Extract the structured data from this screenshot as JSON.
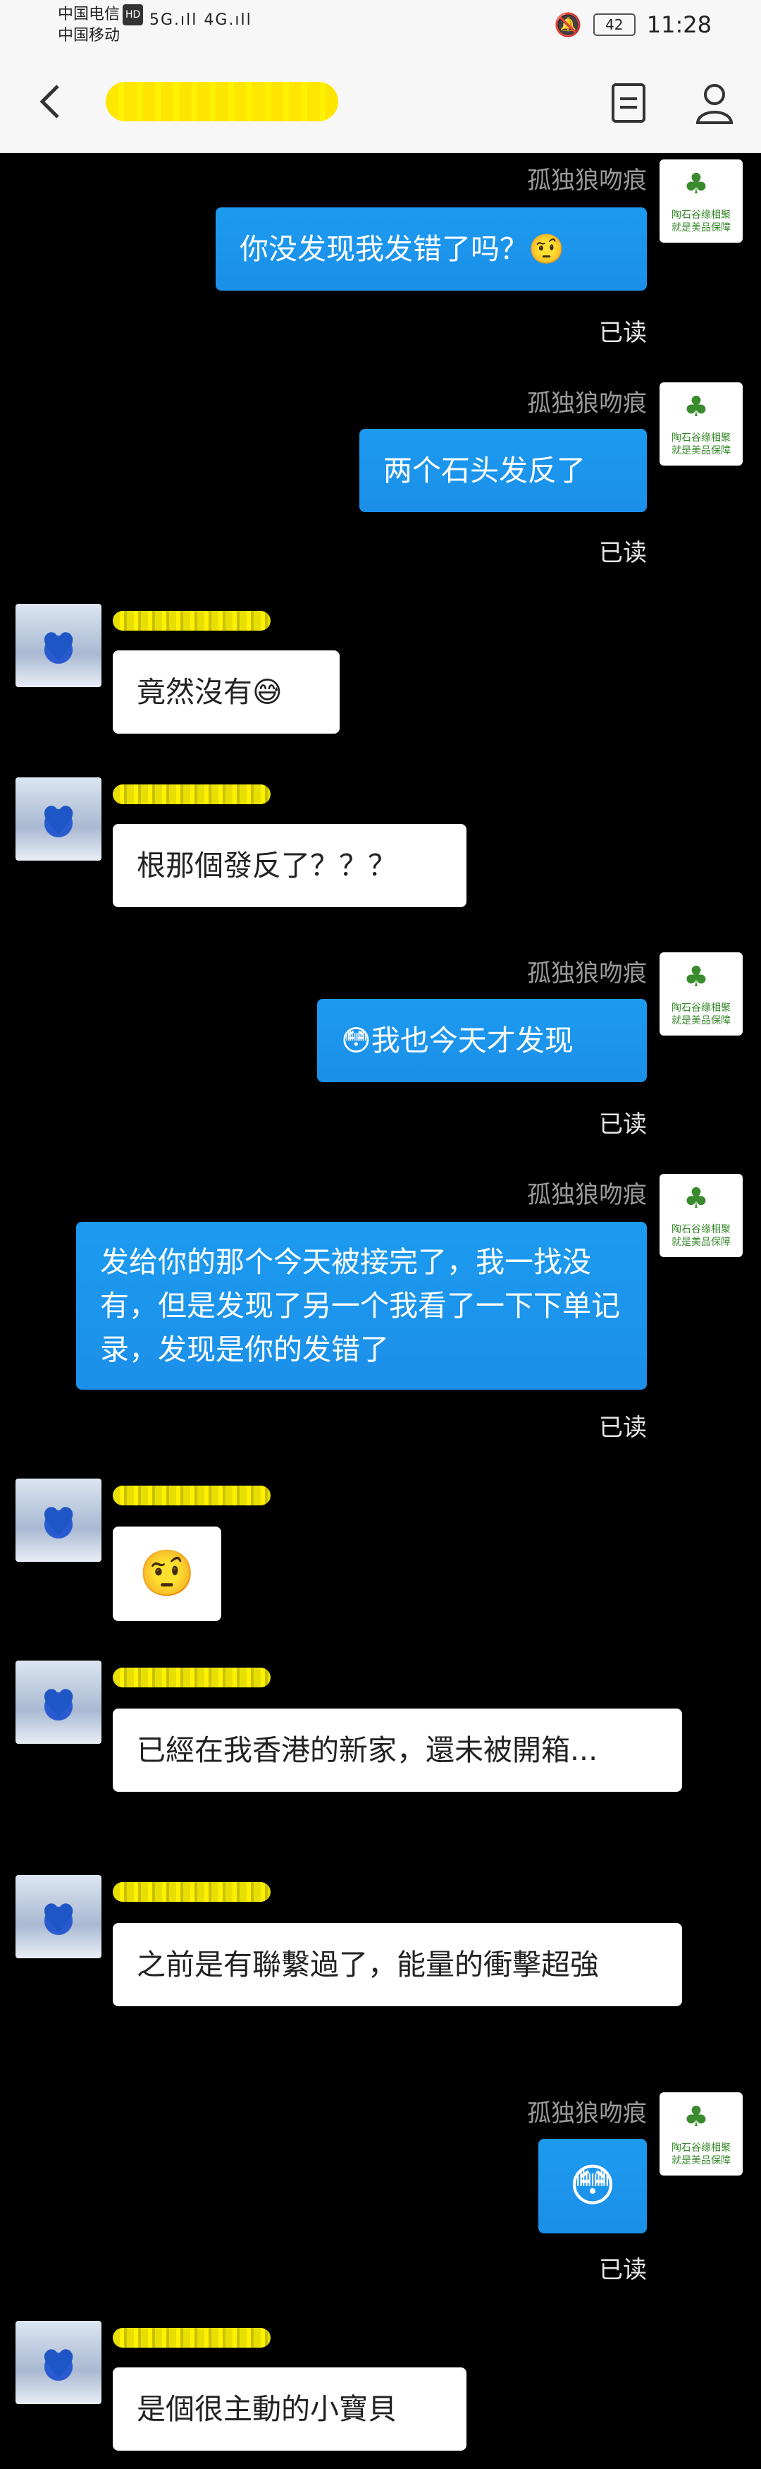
{
  "status": {
    "carrier1": "中国电信",
    "carrier2": "中国移动",
    "hd": "HD",
    "signals": "5G.ıll 4G.ıll",
    "battery": "42",
    "time": "11:28"
  },
  "header": {
    "contact_name": "████████"
  },
  "chat": {
    "my_name": "孤独狼吻痕",
    "avatar_seal": "陶石谷缘相聚\n就是美品保障",
    "read_label": "已读",
    "messages": [
      {
        "text": "你没发现我发错了吗？🤨"
      },
      {
        "text": "两个石头发反了"
      },
      {
        "text": "竟然沒有😅"
      },
      {
        "text": "根那個發反了？？？"
      },
      {
        "text": "😳我也今天才发现"
      },
      {
        "text": "发给你的那个今天被接完了，我一找没有，但是发现了另一个我看了一下下单记录，发现是你的发错了"
      },
      {
        "text": "🤨"
      },
      {
        "text": "已經在我香港的新家，還未被開箱..."
      },
      {
        "text": "之前是有聯繫過了，能量的衝擊超強"
      },
      {
        "text": "😳"
      },
      {
        "text": "是個很主動的小寶貝"
      }
    ]
  }
}
